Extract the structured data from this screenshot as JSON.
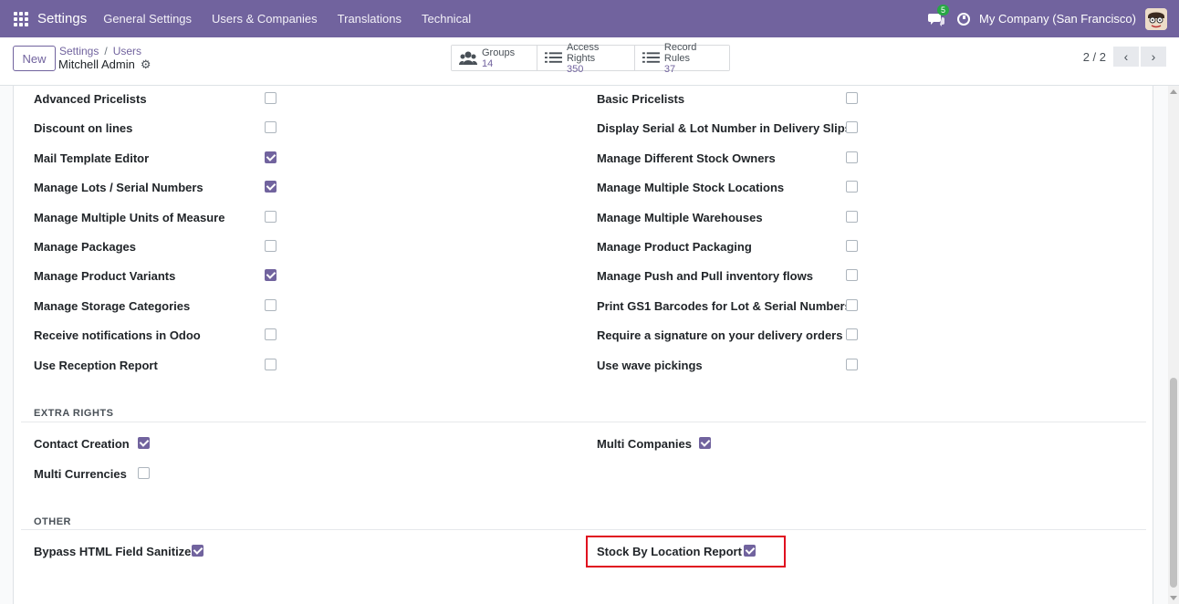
{
  "topbar": {
    "brand": "Settings",
    "menu": [
      "General Settings",
      "Users & Companies",
      "Translations",
      "Technical"
    ],
    "chat_badge": "5",
    "company": "My Company (San Francisco)",
    "icons": [
      "apps-grid-icon",
      "chat-icon",
      "clock-icon",
      "avatar"
    ]
  },
  "control": {
    "new_label": "New",
    "breadcrumb": [
      "Settings",
      "Users"
    ],
    "record_name": "Mitchell Admin",
    "smart_buttons": [
      {
        "label": "Groups",
        "value": "14",
        "icon": "users-icon"
      },
      {
        "label": "Access Rights",
        "value": "350",
        "icon": "list-icon"
      },
      {
        "label": "Record Rules",
        "value": "37",
        "icon": "list-icon"
      }
    ],
    "pager": "2 / 2"
  },
  "technical_left": [
    {
      "label": "Advanced Pricelists",
      "checked": false
    },
    {
      "label": "Discount on lines",
      "checked": false
    },
    {
      "label": "Mail Template Editor",
      "checked": true
    },
    {
      "label": "Manage Lots / Serial Numbers",
      "checked": true
    },
    {
      "label": "Manage Multiple Units of Measure",
      "checked": false
    },
    {
      "label": "Manage Packages",
      "checked": false
    },
    {
      "label": "Manage Product Variants",
      "checked": true
    },
    {
      "label": "Manage Storage Categories",
      "checked": false
    },
    {
      "label": "Receive notifications in Odoo",
      "checked": false
    },
    {
      "label": "Use Reception Report",
      "checked": false
    }
  ],
  "technical_right": [
    {
      "label": "Basic Pricelists",
      "checked": false
    },
    {
      "label": "Display Serial & Lot Number in Delivery Slips",
      "checked": false
    },
    {
      "label": "Manage Different Stock Owners",
      "checked": false
    },
    {
      "label": "Manage Multiple Stock Locations",
      "checked": false
    },
    {
      "label": "Manage Multiple Warehouses",
      "checked": false
    },
    {
      "label": "Manage Product Packaging",
      "checked": false
    },
    {
      "label": "Manage Push and Pull inventory flows",
      "checked": false
    },
    {
      "label": "Print GS1 Barcodes for Lot & Serial Numbers",
      "checked": false
    },
    {
      "label": "Require a signature on your delivery orders",
      "checked": false
    },
    {
      "label": "Use wave pickings",
      "checked": false
    }
  ],
  "extra_rights": {
    "title": "EXTRA RIGHTS",
    "items": [
      {
        "label": "Contact Creation",
        "checked": true
      },
      {
        "label": "Multi Companies",
        "checked": true
      },
      {
        "label": "Multi Currencies",
        "checked": false
      }
    ]
  },
  "other": {
    "title": "OTHER",
    "items": [
      {
        "label": "Bypass HTML Field Sanitize",
        "checked": true
      },
      {
        "label": "Stock By Location Report",
        "checked": true
      }
    ]
  },
  "colors": {
    "brand": "#71639e",
    "highlight": "#e0101f"
  }
}
